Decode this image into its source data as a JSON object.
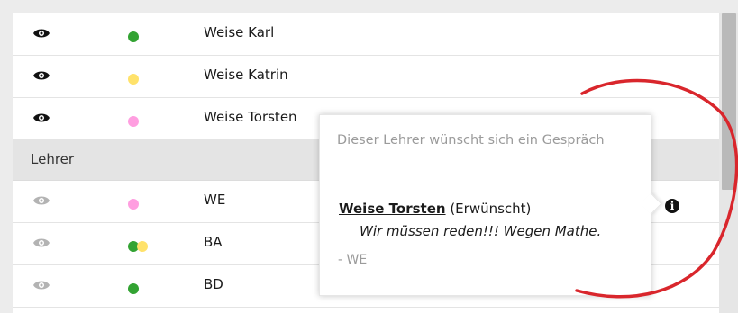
{
  "colors": {
    "green": "#33a333",
    "yellow": "#ffe26b",
    "pink": "#ff9ee0",
    "eye_active": "#111111",
    "eye_inactive": "#b3b3b3",
    "annotation_red": "#d9262c"
  },
  "students": [
    {
      "name": "Weise Karl",
      "status": [
        "green"
      ],
      "eye": "eye-icon"
    },
    {
      "name": "Weise Katrin",
      "status": [
        "yellow"
      ],
      "eye": "eye-icon"
    },
    {
      "name": "Weise Torsten",
      "status": [
        "pink"
      ],
      "eye": "eye-icon"
    }
  ],
  "teachers_section": {
    "label": "Lehrer",
    "rows": [
      {
        "name": "WE",
        "status": [
          "pink"
        ],
        "eye": "eye-icon"
      },
      {
        "name": "BA",
        "status": [
          "green",
          "yellow"
        ],
        "eye": "eye-icon"
      },
      {
        "name": "BD",
        "status": [
          "green"
        ],
        "eye": "eye-icon"
      }
    ]
  },
  "info_icon": "info-icon",
  "popover": {
    "title": "Dieser Lehrer wünscht sich ein Gespräch",
    "entry_name": "Weise Torsten",
    "entry_status": "(Erwünscht)",
    "quote": "Wir müssen reden!!! Wegen Mathe.",
    "author": "- WE"
  }
}
